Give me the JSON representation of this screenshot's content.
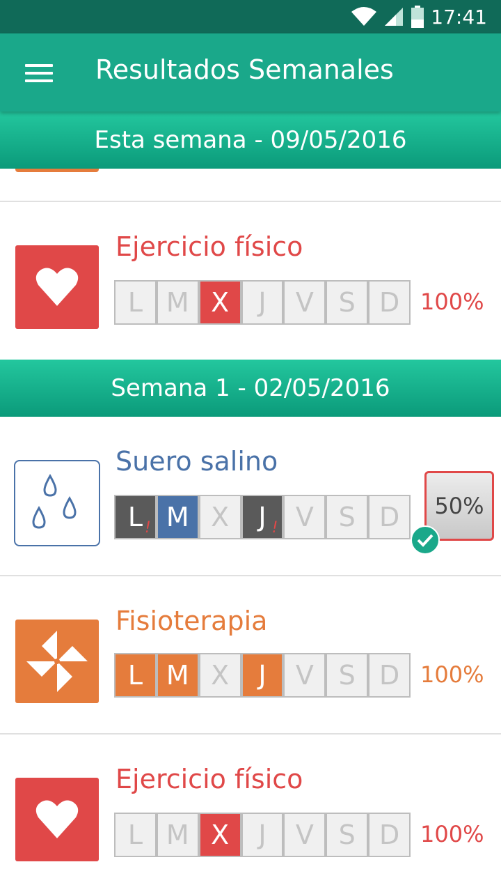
{
  "status": {
    "time": "17:41"
  },
  "appbar": {
    "title": "Resultados Semanales"
  },
  "sections": [
    {
      "header": "Esta semana - 09/05/2016"
    },
    {
      "header": "Semana 1 - 02/05/2016"
    }
  ],
  "items": [
    {
      "name": "Ejercicio físico",
      "icon": "heart-icon",
      "color": "#e04848",
      "days": [
        {
          "label": "L",
          "state": "none"
        },
        {
          "label": "M",
          "state": "none"
        },
        {
          "label": "X",
          "state": "done"
        },
        {
          "label": "J",
          "state": "none"
        },
        {
          "label": "V",
          "state": "none"
        },
        {
          "label": "S",
          "state": "none"
        },
        {
          "label": "D",
          "state": "none"
        }
      ],
      "percent": "100%"
    },
    {
      "name": "Suero salino",
      "icon": "drops-icon",
      "color": "#4a72a8",
      "days": [
        {
          "label": "L",
          "state": "missed",
          "mark": "!"
        },
        {
          "label": "M",
          "state": "done"
        },
        {
          "label": "X",
          "state": "none"
        },
        {
          "label": "J",
          "state": "missed",
          "mark": "!"
        },
        {
          "label": "V",
          "state": "none"
        },
        {
          "label": "S",
          "state": "none"
        },
        {
          "label": "D",
          "state": "none"
        }
      ],
      "percent": "50%"
    },
    {
      "name": "Fisioterapia",
      "icon": "pinwheel-icon",
      "color": "#e57c3c",
      "days": [
        {
          "label": "L",
          "state": "done"
        },
        {
          "label": "M",
          "state": "done"
        },
        {
          "label": "X",
          "state": "none"
        },
        {
          "label": "J",
          "state": "done"
        },
        {
          "label": "V",
          "state": "none"
        },
        {
          "label": "S",
          "state": "none"
        },
        {
          "label": "D",
          "state": "none"
        }
      ],
      "percent": "100%"
    },
    {
      "name": "Ejercicio físico",
      "icon": "heart-icon",
      "color": "#e04848",
      "days": [
        {
          "label": "L",
          "state": "none"
        },
        {
          "label": "M",
          "state": "none"
        },
        {
          "label": "X",
          "state": "done"
        },
        {
          "label": "J",
          "state": "none"
        },
        {
          "label": "V",
          "state": "none"
        },
        {
          "label": "S",
          "state": "none"
        },
        {
          "label": "D",
          "state": "none"
        }
      ],
      "percent": "100%"
    }
  ]
}
